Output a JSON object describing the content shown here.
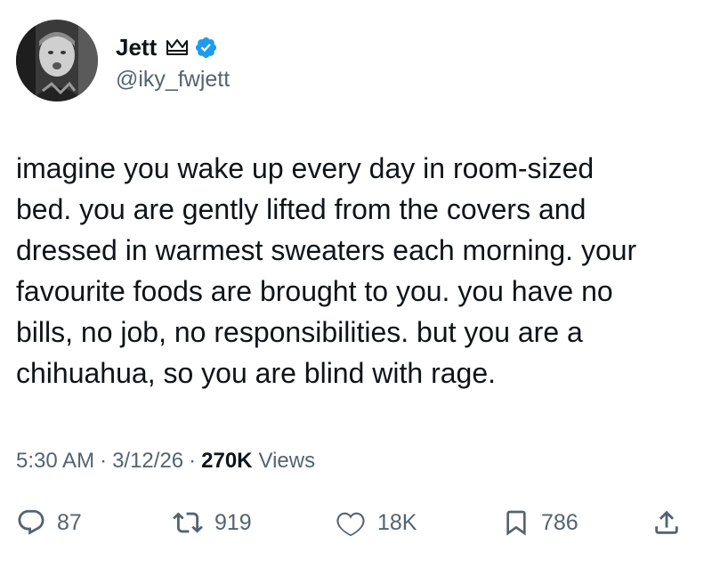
{
  "user": {
    "display_name": "Jett",
    "handle": "@iky_fwjett",
    "verified": true
  },
  "tweet": {
    "text": "imagine you wake up every day in room-sized\nbed. you are gently lifted from the covers and\ndressed in warmest sweaters each morning. your\nfavourite foods are brought to you. you have no\nbills, no job, no responsibilities. but you are a\nchihuahua, so you are blind with rage."
  },
  "meta": {
    "time": "5:30 AM",
    "date": "3/12/26",
    "separator": "·",
    "views_count": "270K",
    "views_label": "Views"
  },
  "actions": {
    "replies": "87",
    "retweets": "919",
    "likes": "18K",
    "bookmarks": "786"
  },
  "colors": {
    "text": "#0f1419",
    "secondary": "#536471",
    "verified": "#1d9bf0"
  }
}
